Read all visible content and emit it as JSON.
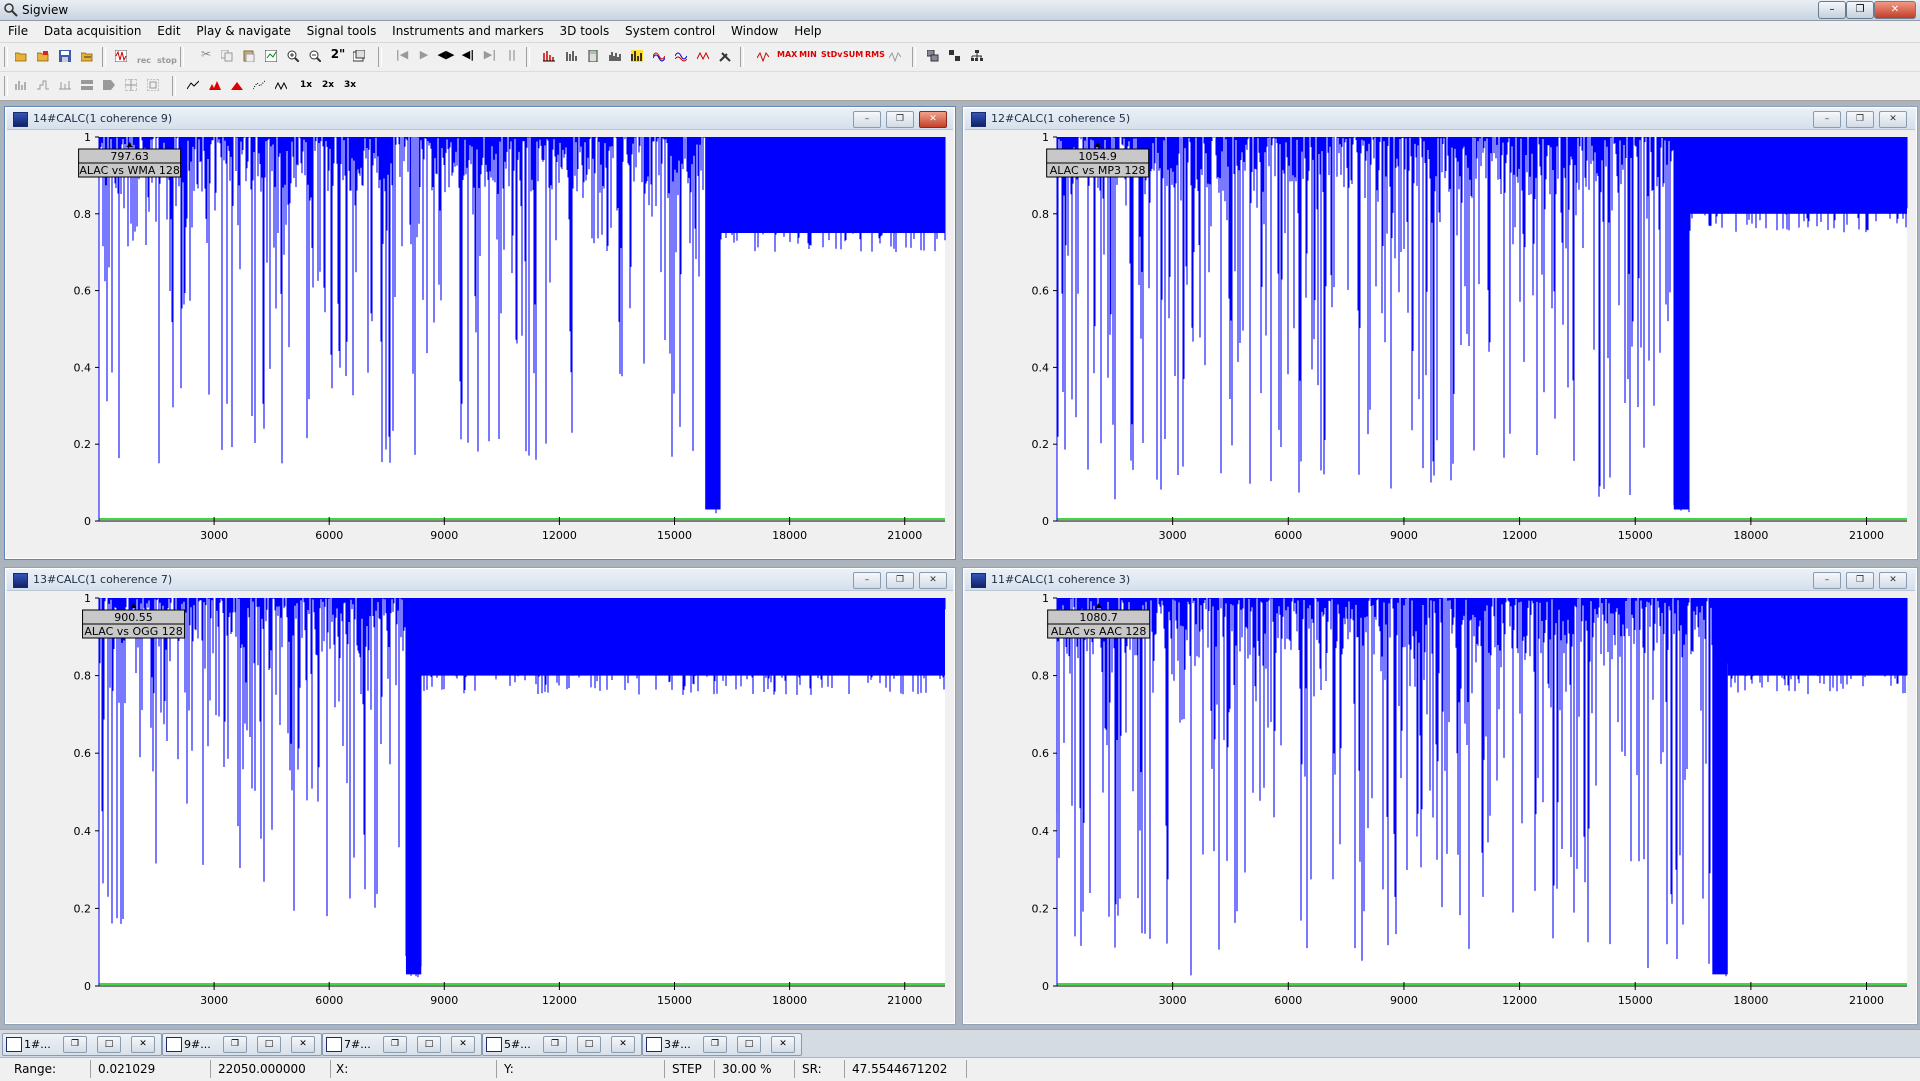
{
  "window": {
    "title": "Sigview"
  },
  "menu": [
    "File",
    "Data acquisition",
    "Edit",
    "Play & navigate",
    "Signal tools",
    "Instruments and markers",
    "3D tools",
    "System control",
    "Window",
    "Help"
  ],
  "toolbar_text": {
    "rec": "rec",
    "stop": "stop",
    "zoom2": "2\"",
    "max": "MAX",
    "min": "MIN",
    "stdv": "StDv",
    "sum": "SUM",
    "rms": "RMS",
    "x1": "1x",
    "x2": "2x",
    "x3": "3x"
  },
  "colors": {
    "signal": "#0000ff",
    "baseline": "#00cc00",
    "axis": "#0000ff"
  },
  "plots": [
    {
      "id": "p14",
      "title": "14#CALC(1 coherence 9)",
      "active": true,
      "marker_value": "797.63",
      "marker_label": "ALAC vs WMA 128",
      "marker_x": 797.63,
      "cutoff_hz": 15800,
      "low_band_floor": 0.15,
      "high_band_floor": 0.75
    },
    {
      "id": "p12",
      "title": "12#CALC(1 coherence 5)",
      "active": false,
      "marker_value": "1054.9",
      "marker_label": "ALAC vs MP3 128",
      "marker_x": 1054.9,
      "cutoff_hz": 16000,
      "low_band_floor": 0.05,
      "high_band_floor": 0.8
    },
    {
      "id": "p13",
      "title": "13#CALC(1 coherence 7)",
      "active": false,
      "marker_value": "900.55",
      "marker_label": "ALAC vs OGG 128",
      "marker_x": 900.55,
      "cutoff_hz": 8000,
      "low_band_floor": 0.15,
      "high_band_floor": 0.8
    },
    {
      "id": "p11",
      "title": "11#CALC(1 coherence 3)",
      "active": false,
      "marker_value": "1080.7",
      "marker_label": "ALAC vs AAC 128",
      "marker_x": 1080.7,
      "cutoff_hz": 17000,
      "low_band_floor": 0.02,
      "high_band_floor": 0.8
    }
  ],
  "chart_data": [
    {
      "type": "area",
      "series": [
        {
          "name": "ALAC vs WMA 128"
        }
      ],
      "x_ticks": [
        3000,
        6000,
        9000,
        12000,
        15000,
        18000,
        21000
      ],
      "y_ticks": [
        0,
        0.2,
        0.4,
        0.6,
        0.8,
        1
      ],
      "xlim": [
        0,
        22050
      ],
      "ylim": [
        0,
        1
      ],
      "grid": false,
      "legend": "top-left marker"
    },
    {
      "type": "area",
      "series": [
        {
          "name": "ALAC vs MP3 128"
        }
      ],
      "x_ticks": [
        3000,
        6000,
        9000,
        12000,
        15000,
        18000,
        21000
      ],
      "y_ticks": [
        0,
        0.2,
        0.4,
        0.6,
        0.8,
        1
      ],
      "xlim": [
        0,
        22050
      ],
      "ylim": [
        0,
        1
      ],
      "grid": false,
      "legend": "top-left marker"
    },
    {
      "type": "area",
      "series": [
        {
          "name": "ALAC vs OGG 128"
        }
      ],
      "x_ticks": [
        3000,
        6000,
        9000,
        12000,
        15000,
        18000,
        21000
      ],
      "y_ticks": [
        0,
        0.2,
        0.4,
        0.6,
        0.8,
        1
      ],
      "xlim": [
        0,
        22050
      ],
      "ylim": [
        0,
        1
      ],
      "grid": false,
      "legend": "top-left marker"
    },
    {
      "type": "area",
      "series": [
        {
          "name": "ALAC vs AAC 128"
        }
      ],
      "x_ticks": [
        3000,
        6000,
        9000,
        12000,
        15000,
        18000,
        21000
      ],
      "y_ticks": [
        0,
        0.2,
        0.4,
        0.6,
        0.8,
        1
      ],
      "xlim": [
        0,
        22050
      ],
      "ylim": [
        0,
        1
      ],
      "grid": false,
      "legend": "top-left marker"
    }
  ],
  "taskbar": [
    {
      "label": "1#..."
    },
    {
      "label": "9#..."
    },
    {
      "label": "7#..."
    },
    {
      "label": "5#..."
    },
    {
      "label": "3#..."
    }
  ],
  "status": {
    "range_label": "Range:",
    "range_from": "0.021029",
    "range_to": "22050.000000",
    "x_label": "X:",
    "x_value": "",
    "y_label": "Y:",
    "y_value": "",
    "step_label": "STEP",
    "step_value": "30.00 %",
    "sr_label": "SR:",
    "sr_value": "47.5544671202"
  }
}
